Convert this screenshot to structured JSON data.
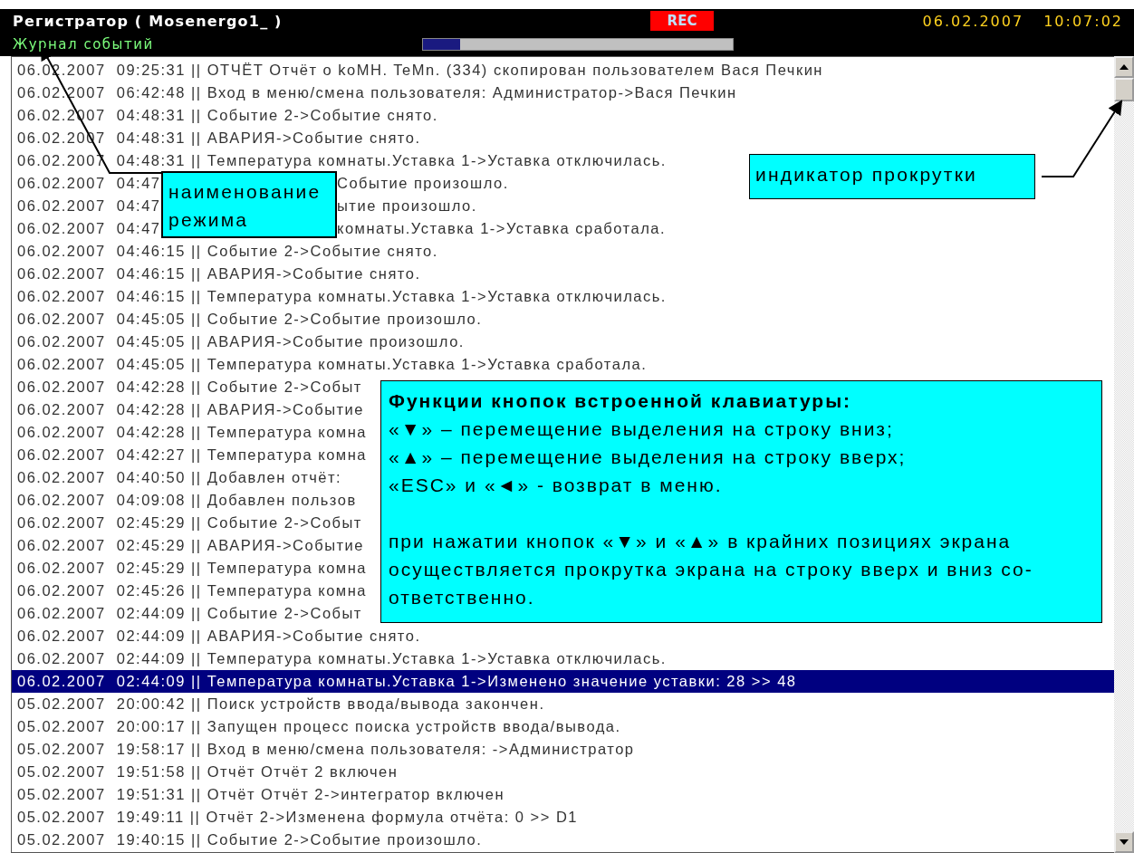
{
  "header": {
    "title": "Регистратор ( Mosenergo1_ )",
    "rec": "REC",
    "date": "06.02.2007",
    "time": "10:07:02",
    "mode": "Журнал событий",
    "progress": {
      "level": 0.12
    }
  },
  "log": [
    {
      "text": "06.02.2007  09:25:31 || ОТЧЁТ Отчёт о koMH. TeMn. (334) скопирован пользователем Вася Печкин",
      "selected": false
    },
    {
      "text": "06.02.2007  06:42:48 || Вход в меню/смена пользователя: Администратор->Вася Печкин",
      "selected": false
    },
    {
      "text": "06.02.2007  04:48:31 || Событие 2->Событие снято.",
      "selected": false
    },
    {
      "text": "06.02.2007  04:48:31 || АВАРИЯ->Событие снято.",
      "selected": false
    },
    {
      "text": "06.02.2007  04:48:31 || Температура комнаты.Уставка 1->Уставка отключилась.",
      "selected": false
    },
    {
      "text": "06.02.2007  04:47",
      "tail": "Событие произошло.",
      "selected": false
    },
    {
      "text": "06.02.2007  04:47",
      "tail": "ытие произошло.",
      "selected": false
    },
    {
      "text": "06.02.2007  04:47",
      "tail": "комнаты.Уставка 1->Уставка сработала.",
      "selected": false
    },
    {
      "text": "06.02.2007  04:46:15 || Событие 2->Событие снято.",
      "selected": false
    },
    {
      "text": "06.02.2007  04:46:15 || АВАРИЯ->Событие снято.",
      "selected": false
    },
    {
      "text": "06.02.2007  04:46:15 || Температура комнаты.Уставка 1->Уставка отключилась.",
      "selected": false
    },
    {
      "text": "06.02.2007  04:45:05 || Событие 2->Событие произошло.",
      "selected": false
    },
    {
      "text": "06.02.2007  04:45:05 || АВАРИЯ->Событие произошло.",
      "selected": false
    },
    {
      "text": "06.02.2007  04:45:05 || Температура комнаты.Уставка 1->Уставка сработала.",
      "selected": false
    },
    {
      "text": "06.02.2007  04:42:28 || Событие 2->Событ",
      "selected": false
    },
    {
      "text": "06.02.2007  04:42:28 || АВАРИЯ->Событие",
      "selected": false
    },
    {
      "text": "06.02.2007  04:42:28 || Температура комна",
      "selected": false
    },
    {
      "text": "06.02.2007  04:42:27 || Температура комна",
      "selected": false
    },
    {
      "text": "06.02.2007  04:40:50 || Добавлен отчёт:",
      "selected": false
    },
    {
      "text": "06.02.2007  04:09:08 || Добавлен пользов",
      "selected": false
    },
    {
      "text": "06.02.2007  02:45:29 || Событие 2->Событ",
      "selected": false
    },
    {
      "text": "06.02.2007  02:45:29 || АВАРИЯ->Событие",
      "selected": false
    },
    {
      "text": "06.02.2007  02:45:29 || Температура комна",
      "selected": false
    },
    {
      "text": "06.02.2007  02:45:26 || Температура комна",
      "selected": false
    },
    {
      "text": "06.02.2007  02:44:09 || Событие 2->Событ",
      "selected": false
    },
    {
      "text": "06.02.2007  02:44:09 || АВАРИЯ->Событие снято.",
      "selected": false
    },
    {
      "text": "06.02.2007  02:44:09 || Температура комнаты.Уставка 1->Уставка отключилась.",
      "selected": false
    },
    {
      "text": "06.02.2007  02:44:09 || Температура комнаты.Уставка 1->Изменено значение уставки: 28 >> 48",
      "selected": true
    },
    {
      "text": "05.02.2007  20:00:42 || Поиск устройств ввода/вывода закончен.",
      "selected": false
    },
    {
      "text": "05.02.2007  20:00:17 || Запущен процесс поиска устройств ввода/вывода.",
      "selected": false
    },
    {
      "text": "05.02.2007  19:58:17 || Вход в меню/смена пользователя: ->Администратор",
      "selected": false
    },
    {
      "text": "05.02.2007  19:51:58 || Отчёт Отчёт 2 включен",
      "selected": false
    },
    {
      "text": "05.02.2007  19:51:31 || Отчёт Отчёт 2->интегратор включен",
      "selected": false
    },
    {
      "text": "05.02.2007  19:49:11 || Отчёт 2->Изменена формула отчёта: 0 >> D1",
      "selected": false
    },
    {
      "text": "05.02.2007  19:40:15 || Событие 2->Событие произошло.",
      "selected": false
    }
  ],
  "callouts": {
    "mode_label": "наименование режима",
    "scroll_label": "индикатор прокрутки",
    "keys": {
      "title": "Функции кнопок встроенной клавиатуры:",
      "lines": [
        "«▼» – перемещение выделения на строку вниз;",
        "«▲» – перемещение выделения на строку вверх;",
        "«ESC» и «◄» - возврат в меню."
      ],
      "note": "при нажатии кнопок «▼» и «▲» в крайних позициях экрана осуществляется прокрутка экрана на строку вверх и вниз со-ответственно."
    }
  }
}
